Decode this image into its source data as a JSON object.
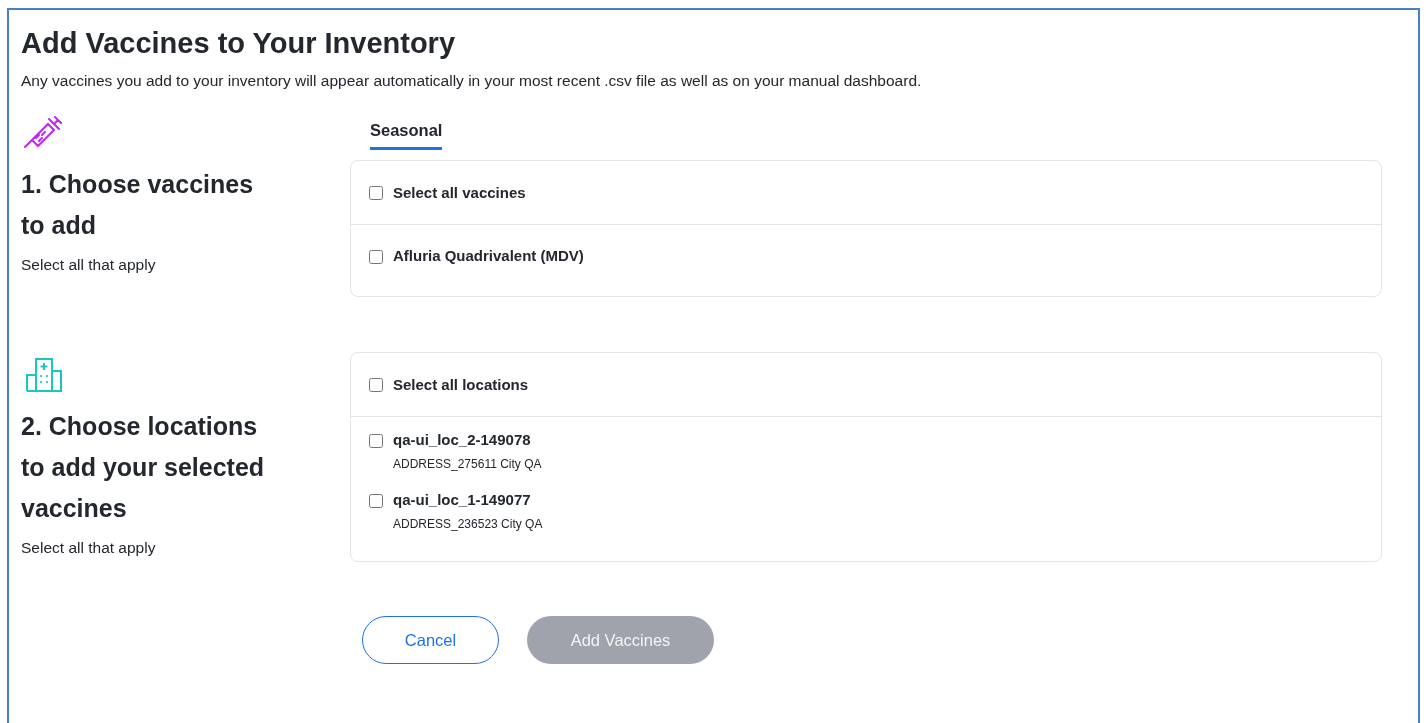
{
  "title": "Add Vaccines to Your Inventory",
  "description": "Any vaccines you add to your inventory will appear automatically in your most recent .csv file as well as on your manual dashboard.",
  "steps": [
    {
      "kind": "vaccines",
      "heading": "1. Choose vaccines to add",
      "hint": "Select all that apply",
      "tabs": [
        {
          "label": "Seasonal",
          "selected": true
        }
      ],
      "select_all": {
        "label": "Select all vaccines",
        "checked": false
      },
      "items": [
        {
          "name": "Afluria Quadrivalent (MDV)",
          "checked": false
        }
      ]
    },
    {
      "kind": "locations",
      "heading": "2. Choose locations to add your selected vaccines",
      "hint": "Select all that apply",
      "select_all": {
        "label": "Select all locations",
        "checked": false
      },
      "items": [
        {
          "name": "qa-ui_loc_2-149078",
          "address": "ADDRESS_275611 City QA",
          "checked": false
        },
        {
          "name": "qa-ui_loc_1-149077",
          "address": "ADDRESS_236523 City QA",
          "checked": false
        }
      ]
    }
  ],
  "buttons": [
    {
      "label": "Cancel",
      "kind": "secondary",
      "disabled": false
    },
    {
      "label": "Add Vaccines",
      "kind": "primary",
      "disabled": true
    }
  ]
}
